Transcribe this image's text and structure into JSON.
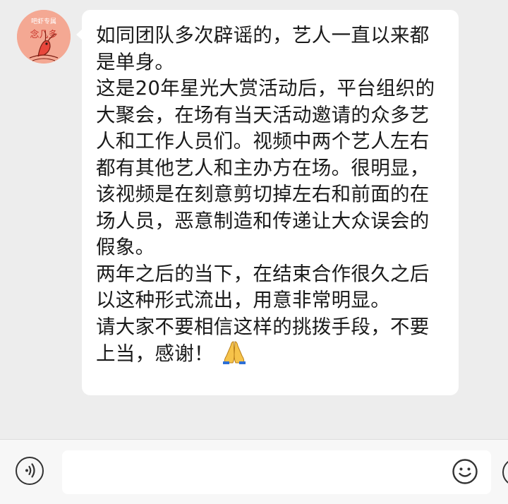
{
  "avatar": {
    "caption": "吧虾专属",
    "text": "念几多"
  },
  "message": {
    "paragraphs": [
      "如同团队多次辟谣的，艺人一直以来都是单身。",
      "这是20年星光大赏活动后，平台组织的大聚会，在场有当天活动邀请的众多艺人和工作人员们。视频中两个艺人左右都有其他艺人和主办方在场。很明显，该视频是在刻意剪切掉左右和前面的在场人员，恶意制造和传递让大众误会的假象。",
      "两年之后的当下，在结束合作很久之后以这种形式流出，用意非常明显。",
      "请大家不要相信这样的挑拨手段，不要上当，感谢！"
    ],
    "emoji": "folded-hands"
  },
  "input_bar": {
    "placeholder": "",
    "voice_icon": "voice-icon",
    "emoji_icon": "smiley-icon",
    "plus_icon": "plus-icon"
  },
  "colors": {
    "background": "#ededed",
    "bubble": "#ffffff",
    "avatar": "#f4a893",
    "text": "#1a1a1a"
  }
}
